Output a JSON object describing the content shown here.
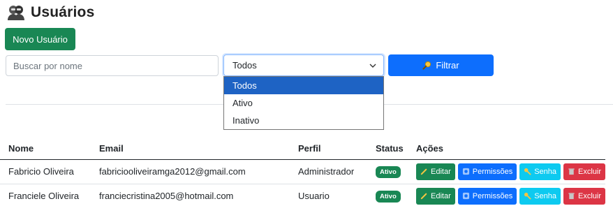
{
  "header": {
    "title": "Usuários",
    "icon": "users-icon"
  },
  "toolbar": {
    "new_user_label": "Novo Usuário"
  },
  "filters": {
    "search_placeholder": "Buscar por nome",
    "status_selected": "Todos",
    "status_options": [
      "Todos",
      "Ativo",
      "Inativo"
    ],
    "filter_label": "Filtrar"
  },
  "table": {
    "columns": [
      "Nome",
      "Email",
      "Perfil",
      "Status",
      "Ações"
    ],
    "rows": [
      {
        "nome": "Fabricio Oliveira",
        "email": "fabriciooliveiramga2012@gmail.com",
        "perfil": "Administrador",
        "status": "Ativo"
      },
      {
        "nome": "Franciele Oliveira",
        "email": "franciecristina2005@hotmail.com",
        "perfil": "Usuario",
        "status": "Ativo"
      }
    ],
    "actions": {
      "edit": "Editar",
      "permissions": "Permissões",
      "password": "Senha",
      "delete": "Excluir"
    }
  },
  "colors": {
    "success": "#198754",
    "primary": "#0d6efd",
    "info": "#0dcaf0",
    "danger": "#dc3545"
  }
}
